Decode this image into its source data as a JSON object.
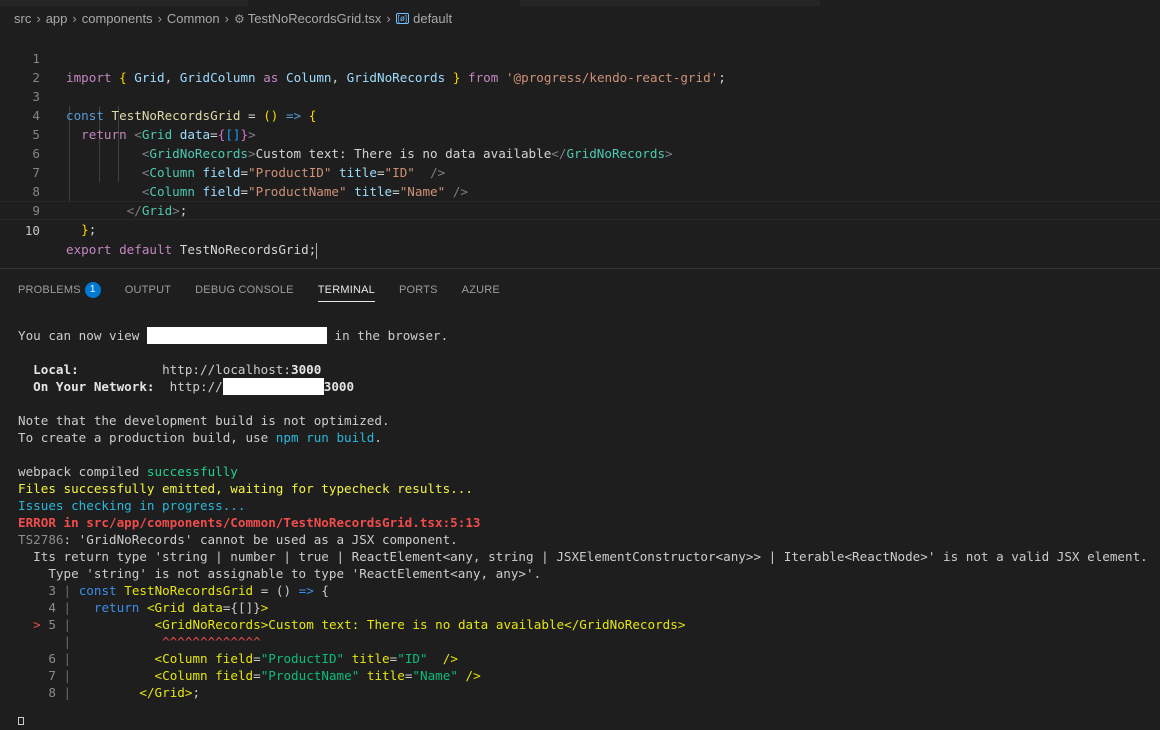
{
  "breadcrumb": {
    "items": [
      "src",
      "app",
      "components",
      "Common",
      "TestNoRecordsGrid.tsx",
      "default"
    ]
  },
  "editor": {
    "line_numbers": [
      "1",
      "2",
      "3",
      "4",
      "5",
      "6",
      "7",
      "8",
      "9",
      "10"
    ],
    "lines": [
      "import { Grid, GridColumn as Column, GridNoRecords } from '@progress/kendo-react-grid';",
      "",
      "const TestNoRecordsGrid = () => {",
      "  return <Grid data={[]}>",
      "          <GridNoRecords>Custom text: There is no data available</GridNoRecords>",
      "          <Column field=\"ProductID\" title=\"ID\"  />",
      "          <Column field=\"ProductName\" title=\"Name\" />",
      "        </Grid>;",
      "  };",
      "export default TestNoRecordsGrid;"
    ]
  },
  "panel": {
    "tabs": [
      "PROBLEMS",
      "OUTPUT",
      "DEBUG CONSOLE",
      "TERMINAL",
      "PORTS",
      "AZURE"
    ],
    "problems_count": "1",
    "active_tab": "TERMINAL"
  },
  "terminal": {
    "view_prefix": "You can now view ",
    "view_suffix": " in the browser.",
    "local_label": "Local:",
    "local_url_prefix": "http://localhost:",
    "local_port": "3000",
    "network_label": "On Your Network:",
    "network_url_prefix": "http://",
    "network_port": "3000",
    "note1": "Note that the development build is not optimized.",
    "note2_prefix": "To create a production build, use ",
    "note2_cmd": "npm run build",
    "note2_suffix": ".",
    "compiled_prefix": "webpack compiled ",
    "compiled_status": "successfully",
    "emitted": "Files successfully emitted, waiting for typecheck results...",
    "issues": "Issues checking in progress...",
    "error": "ERROR in src/app/components/Common/TestNoRecordsGrid.tsx:5:13",
    "ts_code": "TS2786",
    "ts_msg": ": 'GridNoRecords' cannot be used as a JSX component.",
    "return_type": "  Its return type 'string | number | true | ReactElement<any, string | JSXElementConstructor<any>> | Iterable<ReactNode>' is not a valid JSX element.",
    "type_msg": "    Type 'string' is not assignable to type 'ReactElement<any, any>'.",
    "carets": "^^^^^^^^^^^^^"
  }
}
